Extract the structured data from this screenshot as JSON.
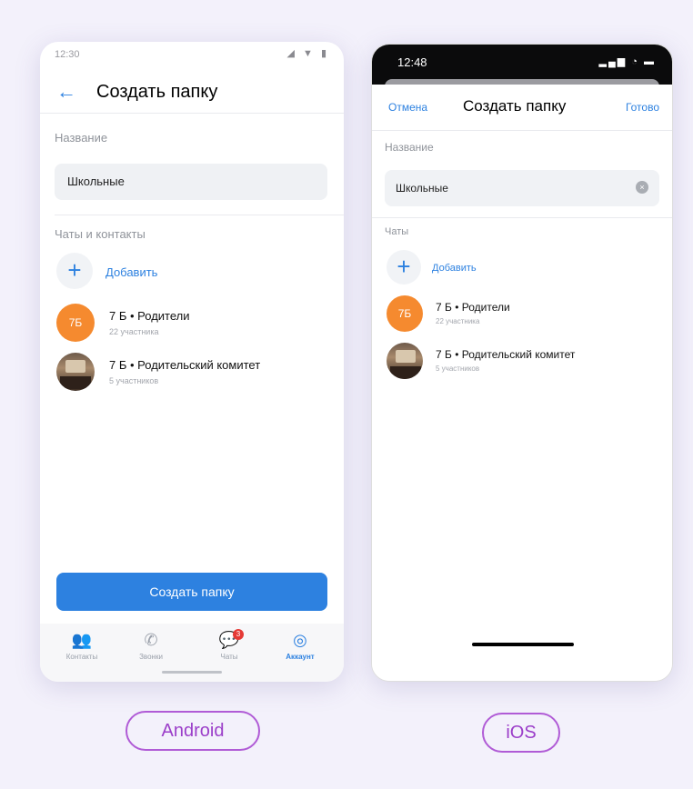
{
  "android": {
    "status_time": "12:30",
    "status_icons": "◢ ▼ ▮",
    "back_icon": "←",
    "title": "Создать папку",
    "name_label": "Название",
    "name_value": "Школьные",
    "section_label": "Чаты и контакты",
    "add_icon": "+",
    "add_label": "Добавить",
    "chats": [
      {
        "avatar_text": "7Б",
        "title": "7 Б • Родители",
        "subtitle": "22 участника"
      },
      {
        "title": "7 Б • Родительский комитет",
        "subtitle": "5 участников"
      }
    ],
    "button_label": "Создать папку",
    "tabs": [
      {
        "icon": "👥",
        "label": "Контакты"
      },
      {
        "icon": "✆",
        "label": "Звонки"
      },
      {
        "icon": "💬",
        "label": "Чаты",
        "badge": "3"
      },
      {
        "icon": "◎",
        "label": "Аккаунт"
      }
    ]
  },
  "ios": {
    "status_time": "12:48",
    "status_icons": "▂▄▆ ◔ ▬",
    "cancel_label": "Отмена",
    "title": "Создать папку",
    "done_label": "Готово",
    "name_label": "Название",
    "name_value": "Школьные",
    "clear_icon": "×",
    "section_label": "Чаты",
    "add_icon": "+",
    "add_label": "Добавить",
    "chats": [
      {
        "avatar_text": "7Б",
        "title": "7 Б • Родители",
        "subtitle": "22 участника"
      },
      {
        "title": "7 Б • Родительский комитет",
        "subtitle": "5 участников"
      }
    ]
  },
  "labels": {
    "android": "Android",
    "ios": "iOS"
  },
  "colors": {
    "accent": "#2d81e0",
    "avatar_orange": "#f58a2f",
    "badge_red": "#e53935",
    "pill_purple": "#9b3ec9"
  }
}
